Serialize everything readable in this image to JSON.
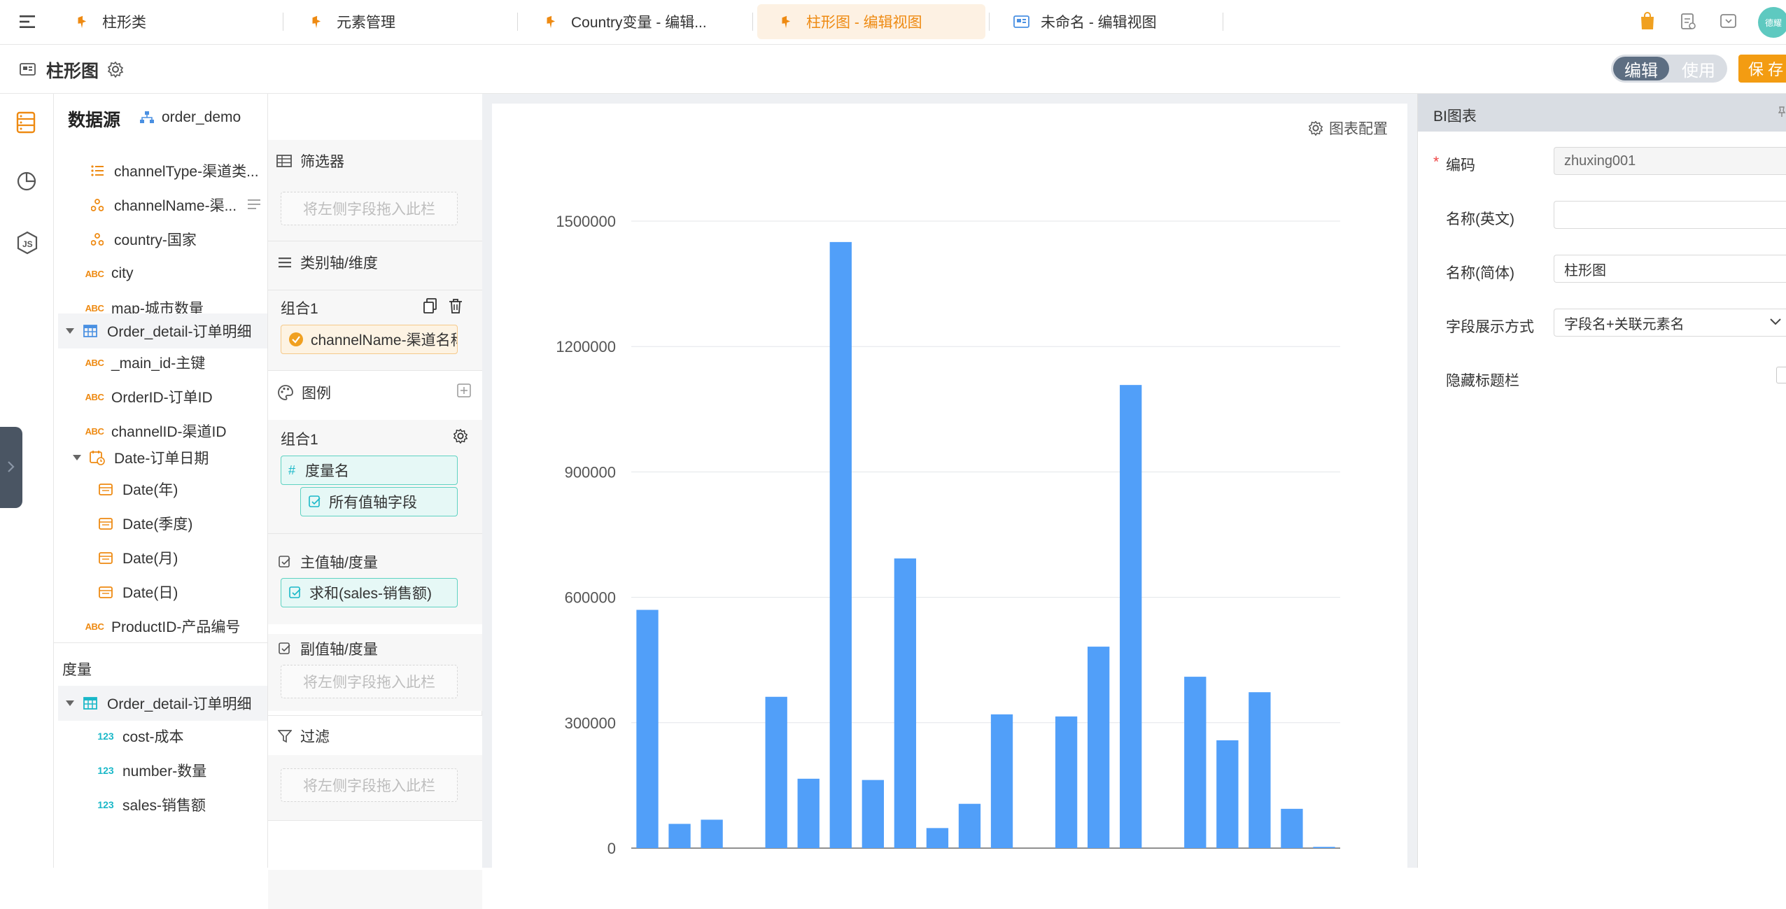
{
  "tabs": [
    {
      "label": "柱形类",
      "icon": "pin-icon",
      "active": false
    },
    {
      "label": "元素管理",
      "icon": "pin-icon",
      "active": false
    },
    {
      "label": "Country变量 - 编辑...",
      "icon": "pin-icon",
      "active": false
    },
    {
      "label": "柱形图 - 编辑视图",
      "icon": "pin-icon",
      "active": true
    },
    {
      "label": "未命名 - 编辑视图",
      "icon": "view-icon",
      "active": false
    }
  ],
  "header": {
    "title": "柱形图",
    "mode_edit": "编辑",
    "mode_use": "使用",
    "save": "保 存",
    "avatar": "德耀"
  },
  "datasource": {
    "label": "数据源",
    "name": "order_demo"
  },
  "fields": {
    "dimension_items": [
      {
        "label": "channelType-渠道类...",
        "icon": "list-icon"
      },
      {
        "label": "channelName-渠...",
        "icon": "hierarchy-icon"
      },
      {
        "label": "country-国家",
        "icon": "hierarchy-icon"
      },
      {
        "label": "city",
        "icon": "abc-icon"
      },
      {
        "label": "map-城市数量",
        "icon": "abc-icon"
      }
    ],
    "order_detail_group": "Order_detail-订单明细",
    "order_detail_items": [
      {
        "label": "_main_id-主键",
        "icon": "abc-icon"
      },
      {
        "label": "OrderID-订单ID",
        "icon": "abc-icon"
      },
      {
        "label": "channelID-渠道ID",
        "icon": "abc-icon"
      }
    ],
    "date_group": "Date-订单日期",
    "date_items": [
      "Date(年)",
      "Date(季度)",
      "Date(月)",
      "Date(日)"
    ],
    "product_item": "ProductID-产品编号",
    "measure_section": "度量",
    "measure_group": "Order_detail-订单明细",
    "measure_items": [
      "cost-成本",
      "number-数量",
      "sales-销售额"
    ],
    "abc_badge": "ABC",
    "num_badge": "123"
  },
  "config": {
    "filter_title": "筛选器",
    "drop_placeholder": "将左侧字段拖入此栏",
    "category_title": "类别轴/维度",
    "group_label": "组合1",
    "category_chip": "channelName-渠道名称",
    "legend_title": "图例",
    "legend_group": "组合1",
    "legend_chip1": "度量名",
    "legend_chip2": "所有值轴字段",
    "main_axis_title": "主值轴/度量",
    "main_axis_chip": "求和(sales-销售额)",
    "sub_axis_title": "副值轴/度量",
    "filter2_title": "过滤"
  },
  "chart_config_label": "图表配置",
  "chart_data": {
    "type": "bar",
    "title": "",
    "xlabel": "",
    "ylabel": "",
    "ylim": [
      0,
      1500000
    ],
    "yticks": [
      "0",
      "300000",
      "600000",
      "900000",
      "1200000",
      "1500000"
    ],
    "values": [
      570000,
      58000,
      68000,
      0,
      362000,
      166000,
      1450000,
      163000,
      693000,
      48000,
      106000,
      320000,
      0,
      315000,
      482000,
      1108000,
      0,
      410000,
      258000,
      373000,
      94000,
      3000
    ],
    "bar_color": "#519ff9",
    "grid": true
  },
  "props": {
    "title": "BI图表",
    "code_label": "编码",
    "code_value": "zhuxing001",
    "name_en_label": "名称(英文)",
    "name_en_value": "",
    "name_cn_label": "名称(简体)",
    "name_cn_value": "柱形图",
    "field_mode_label": "字段展示方式",
    "field_mode_value": "字段名+关联元素名",
    "hide_title_label": "隐藏标题栏"
  },
  "colors": {
    "accent": "#ee8a12",
    "bar": "#519ff9",
    "chip_green_bg": "#e6f8f6",
    "chip_green_border": "#5fd2c2"
  }
}
